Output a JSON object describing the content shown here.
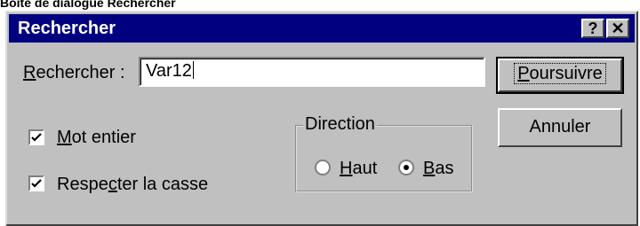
{
  "caption": "Boîte de dialogue Rechercher",
  "dialog": {
    "title": "Rechercher",
    "help_glyph": "?",
    "close_glyph": "✕"
  },
  "search": {
    "label": "Rechercher :",
    "value": "Var12"
  },
  "buttons": {
    "find_next": "Poursuivre",
    "cancel": "Annuler"
  },
  "options": {
    "whole_word": {
      "label": "Mot entier",
      "checked": true
    },
    "match_case": {
      "label": "Respecter la casse",
      "checked": true
    }
  },
  "direction": {
    "legend": "Direction",
    "up": {
      "label": "Haut",
      "selected": false
    },
    "down": {
      "label": "Bas",
      "selected": true
    }
  }
}
